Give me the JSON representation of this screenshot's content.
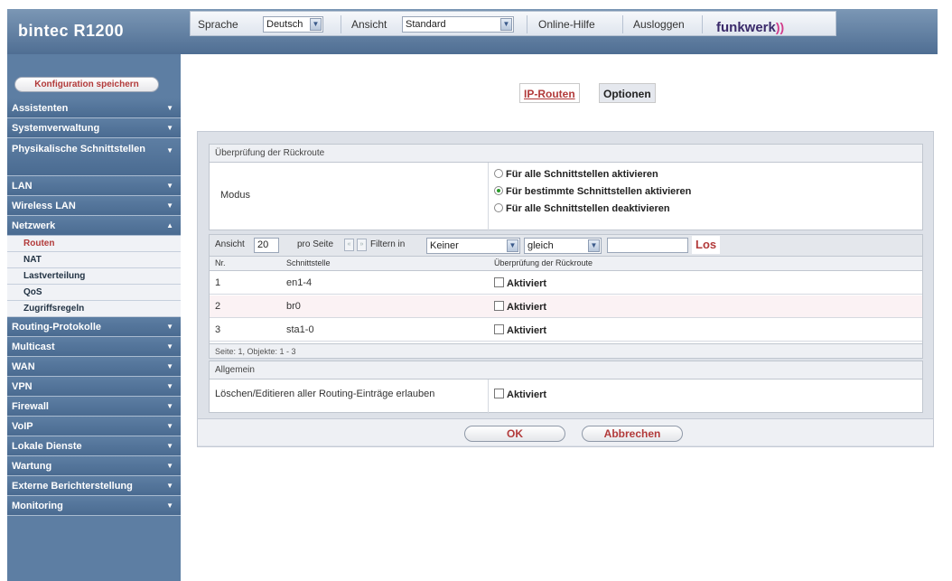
{
  "app": {
    "brand": "bintec R1200",
    "logo": "funkwerk"
  },
  "topbar": {
    "language_label": "Sprache",
    "language_value": "Deutsch",
    "view_label": "Ansicht",
    "view_value": "Standard",
    "help_link": "Online-Hilfe",
    "logout_link": "Ausloggen"
  },
  "sidebar": {
    "save_button": "Konfiguration speichern",
    "items": [
      {
        "label": "Assistenten"
      },
      {
        "label": "Systemverwaltung"
      },
      {
        "label": "Physikalische Schnittstellen"
      },
      {
        "label": "LAN"
      },
      {
        "label": "Wireless LAN"
      },
      {
        "label": "Netzwerk"
      },
      {
        "label": "Routing-Protokolle"
      },
      {
        "label": "Multicast"
      },
      {
        "label": "WAN"
      },
      {
        "label": "VPN"
      },
      {
        "label": "Firewall"
      },
      {
        "label": "VoIP"
      },
      {
        "label": "Lokale Dienste"
      },
      {
        "label": "Wartung"
      },
      {
        "label": "Externe Berichterstellung"
      },
      {
        "label": "Monitoring"
      }
    ],
    "subitems": [
      {
        "label": "Routen"
      },
      {
        "label": "NAT"
      },
      {
        "label": "Lastverteilung"
      },
      {
        "label": "QoS"
      },
      {
        "label": "Zugriffsregeln"
      }
    ]
  },
  "tabs": {
    "active": "IP-Routen",
    "inactive": "Optionen"
  },
  "reverse_route": {
    "title": "Überprüfung der Rückroute",
    "mode_label": "Modus",
    "options": [
      "Für alle Schnittstellen aktivieren",
      "Für bestimmte Schnittstellen aktivieren",
      "Für alle Schnittstellen deaktivieren"
    ],
    "selected_index": 1
  },
  "filter": {
    "view_label": "Ansicht",
    "per_page_value": "20",
    "per_page_label": "pro Seite",
    "filter_label": "Filtern in",
    "field_value": "Keiner",
    "op_value": "gleich",
    "search_value": "",
    "go_button": "Los"
  },
  "table": {
    "columns": [
      "Nr.",
      "Schnittstelle",
      "Überprüfung der Rückroute"
    ],
    "rows": [
      {
        "nr": "1",
        "iface": "en1-4",
        "check": "Aktiviert"
      },
      {
        "nr": "2",
        "iface": "br0",
        "check": "Aktiviert"
      },
      {
        "nr": "3",
        "iface": "sta1-0",
        "check": "Aktiviert"
      }
    ],
    "status": "Seite: 1, Objekte: 1 - 3"
  },
  "general": {
    "title": "Allgemein",
    "label": "Löschen/Editieren aller Routing-Einträge erlauben",
    "check": "Aktiviert"
  },
  "buttons": {
    "ok": "OK",
    "cancel": "Abbrechen"
  }
}
